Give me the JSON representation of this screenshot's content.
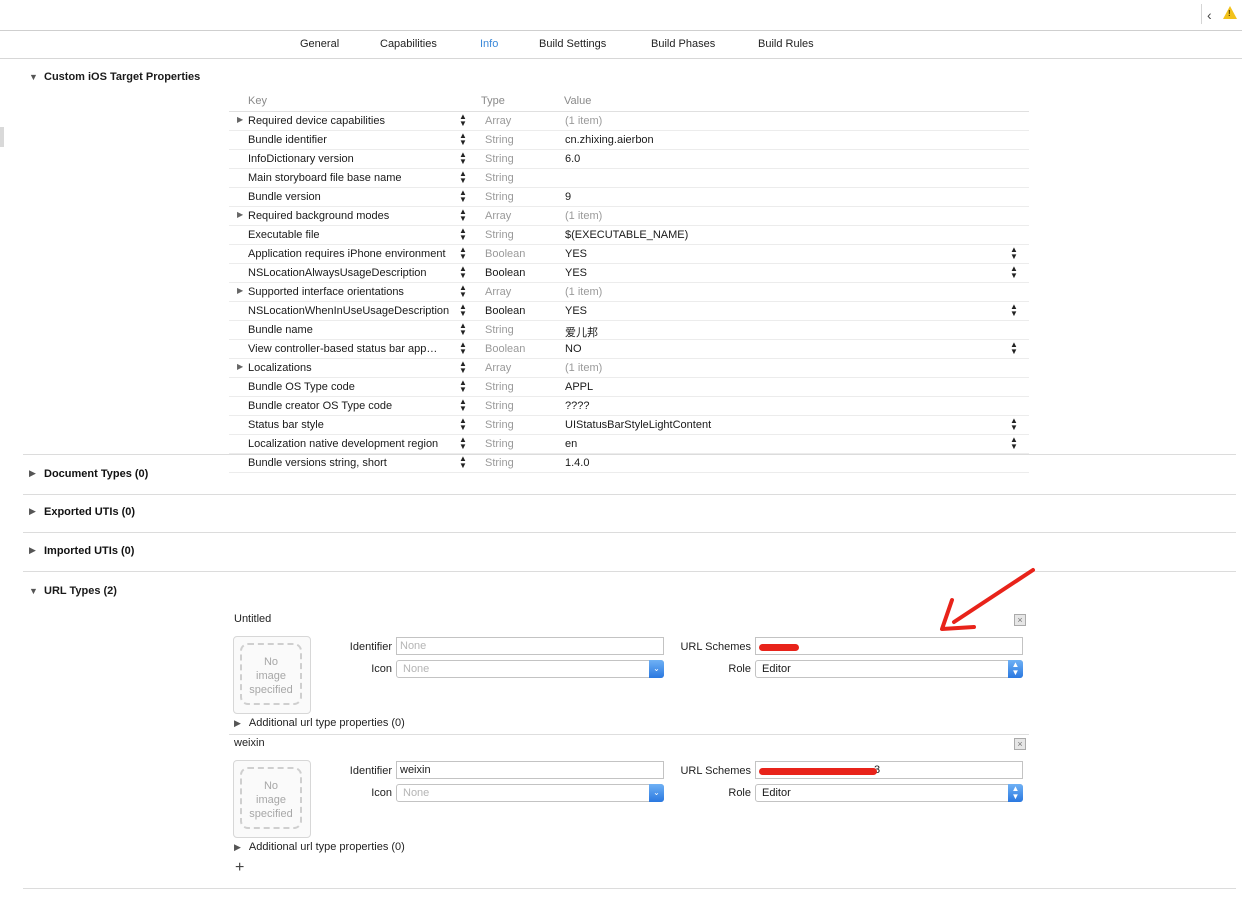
{
  "toolbar": {
    "back_icon": "chevron-left-icon",
    "warning_icon": "warning-icon",
    "warning_glyph": "!"
  },
  "tabs": [
    {
      "label": "General"
    },
    {
      "label": "Capabilities"
    },
    {
      "label": "Info",
      "active": true
    },
    {
      "label": "Build Settings"
    },
    {
      "label": "Build Phases"
    },
    {
      "label": "Build Rules"
    }
  ],
  "custom_props": {
    "title": "Custom iOS Target Properties",
    "columns": {
      "key": "Key",
      "type": "Type",
      "value": "Value"
    },
    "rows": [
      {
        "key": "Required device capabilities",
        "type": "Array",
        "value": "(1 item)",
        "disclosure": true,
        "type_dark": false,
        "value_grey": true,
        "popup": false
      },
      {
        "key": "Bundle identifier",
        "type": "String",
        "value": "cn.zhixing.aierbon",
        "disclosure": false,
        "type_dark": false,
        "value_grey": false,
        "popup": false
      },
      {
        "key": "InfoDictionary version",
        "type": "String",
        "value": "6.0",
        "disclosure": false,
        "type_dark": false,
        "value_grey": false,
        "popup": false
      },
      {
        "key": "Main storyboard file base name",
        "type": "String",
        "value": "",
        "disclosure": false,
        "type_dark": false,
        "value_grey": false,
        "popup": false
      },
      {
        "key": "Bundle version",
        "type": "String",
        "value": "9",
        "disclosure": false,
        "type_dark": false,
        "value_grey": false,
        "popup": false
      },
      {
        "key": "Required background modes",
        "type": "Array",
        "value": "(1 item)",
        "disclosure": true,
        "type_dark": false,
        "value_grey": true,
        "popup": false
      },
      {
        "key": "Executable file",
        "type": "String",
        "value": "$(EXECUTABLE_NAME)",
        "disclosure": false,
        "type_dark": false,
        "value_grey": false,
        "popup": false
      },
      {
        "key": "Application requires iPhone environment",
        "type": "Boolean",
        "value": "YES",
        "disclosure": false,
        "type_dark": false,
        "value_grey": false,
        "popup": true
      },
      {
        "key": "NSLocationAlwaysUsageDescription",
        "type": "Boolean",
        "value": "YES",
        "disclosure": false,
        "type_dark": true,
        "value_grey": false,
        "popup": true
      },
      {
        "key": "Supported interface orientations",
        "type": "Array",
        "value": "(1 item)",
        "disclosure": true,
        "type_dark": false,
        "value_grey": true,
        "popup": false
      },
      {
        "key": "NSLocationWhenInUseUsageDescription",
        "type": "Boolean",
        "value": "YES",
        "disclosure": false,
        "type_dark": true,
        "value_grey": false,
        "popup": true
      },
      {
        "key": "Bundle name",
        "type": "String",
        "value": "爱儿邦",
        "disclosure": false,
        "type_dark": false,
        "value_grey": false,
        "popup": false
      },
      {
        "key": "View controller-based status bar app…",
        "type": "Boolean",
        "value": "NO",
        "disclosure": false,
        "type_dark": false,
        "value_grey": false,
        "popup": true
      },
      {
        "key": "Localizations",
        "type": "Array",
        "value": "(1 item)",
        "disclosure": true,
        "type_dark": false,
        "value_grey": true,
        "popup": false
      },
      {
        "key": "Bundle OS Type code",
        "type": "String",
        "value": "APPL",
        "disclosure": false,
        "type_dark": false,
        "value_grey": false,
        "popup": false
      },
      {
        "key": "Bundle creator OS Type code",
        "type": "String",
        "value": "????",
        "disclosure": false,
        "type_dark": false,
        "value_grey": false,
        "popup": false
      },
      {
        "key": "Status bar style",
        "type": "String",
        "value": "UIStatusBarStyleLightContent",
        "disclosure": false,
        "type_dark": false,
        "value_grey": false,
        "popup": true
      },
      {
        "key": "Localization native development region",
        "type": "String",
        "value": "en",
        "disclosure": false,
        "type_dark": false,
        "value_grey": false,
        "popup": true
      },
      {
        "key": "Bundle versions string, short",
        "type": "String",
        "value": "1.4.0",
        "disclosure": false,
        "type_dark": false,
        "value_grey": false,
        "popup": false
      }
    ]
  },
  "sections": {
    "document_types": "Document Types (0)",
    "exported_utis": "Exported UTIs (0)",
    "imported_utis": "Imported UTIs (0)",
    "url_types": "URL Types (2)"
  },
  "url_types": [
    {
      "name": "Untitled",
      "image_placeholder": "No image specified",
      "identifier_label": "Identifier",
      "identifier_value": "",
      "identifier_placeholder": "None",
      "icon_label": "Icon",
      "icon_placeholder": "None",
      "schemes_label": "URL Schemes",
      "role_label": "Role",
      "role_value": "Editor",
      "additional": "Additional url type properties (0)"
    },
    {
      "name": "weixin",
      "image_placeholder": "No image specified",
      "identifier_label": "Identifier",
      "identifier_value": "weixin",
      "identifier_placeholder": "None",
      "icon_label": "Icon",
      "icon_placeholder": "None",
      "schemes_label": "URL Schemes",
      "schemes_visible_tail": "3",
      "role_label": "Role",
      "role_value": "Editor",
      "additional": "Additional url type properties (0)"
    }
  ],
  "add_button": "+",
  "glyphs": {
    "expanded": "▼",
    "collapsed": "▶",
    "stepper": "▲\n▼",
    "close": "×",
    "combo": "⌄",
    "popup": "⌃⌄"
  },
  "annotation": {
    "arrow_color": "#e8231a",
    "redaction_color": "#e8231a"
  }
}
